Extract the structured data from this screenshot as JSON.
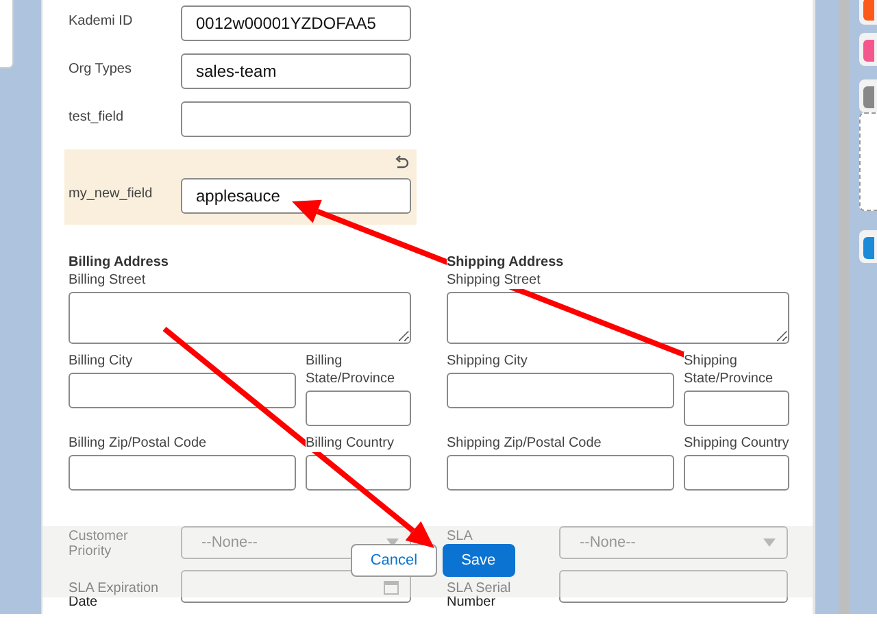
{
  "fields": [
    {
      "label": "Kademi ID",
      "value": "0012w00001YZDOFAA5",
      "modified": false
    },
    {
      "label": "Org Types",
      "value": "sales-team",
      "modified": false
    },
    {
      "label": "test_field",
      "modified": false
    },
    {
      "label": "my_new_field",
      "value": "applesauce",
      "modified": true
    }
  ],
  "addresses": [
    {
      "title": "Billing Address",
      "fields": [
        {
          "label": "Billing Street",
          "kind": "textarea"
        },
        {
          "label": "Billing City",
          "kind": "text"
        },
        {
          "label": "Billing State/Province",
          "kind": "text"
        },
        {
          "label": "Billing Zip/Postal Code",
          "kind": "text"
        },
        {
          "label": "Billing Country",
          "kind": "text"
        }
      ]
    },
    {
      "title": "Shipping Address",
      "fields": [
        {
          "label": "Shipping Street",
          "kind": "textarea"
        },
        {
          "label": "Shipping City",
          "kind": "text"
        },
        {
          "label": "Shipping State/Province",
          "kind": "text"
        },
        {
          "label": "Shipping Zip/Postal Code",
          "kind": "text"
        },
        {
          "label": "Shipping Country",
          "kind": "text"
        }
      ]
    }
  ],
  "more_fields": [
    {
      "label": "Customer Priority",
      "kind": "select",
      "value": "--None--"
    },
    {
      "label": "SLA",
      "kind": "select",
      "value": "--None--"
    },
    {
      "label": "SLA Expiration Date",
      "kind": "date"
    },
    {
      "label": "SLA Serial Number",
      "kind": "text"
    }
  ],
  "buttons": [
    {
      "label": "Cancel",
      "kind": "secondary"
    },
    {
      "label": "Save",
      "kind": "primary"
    }
  ]
}
